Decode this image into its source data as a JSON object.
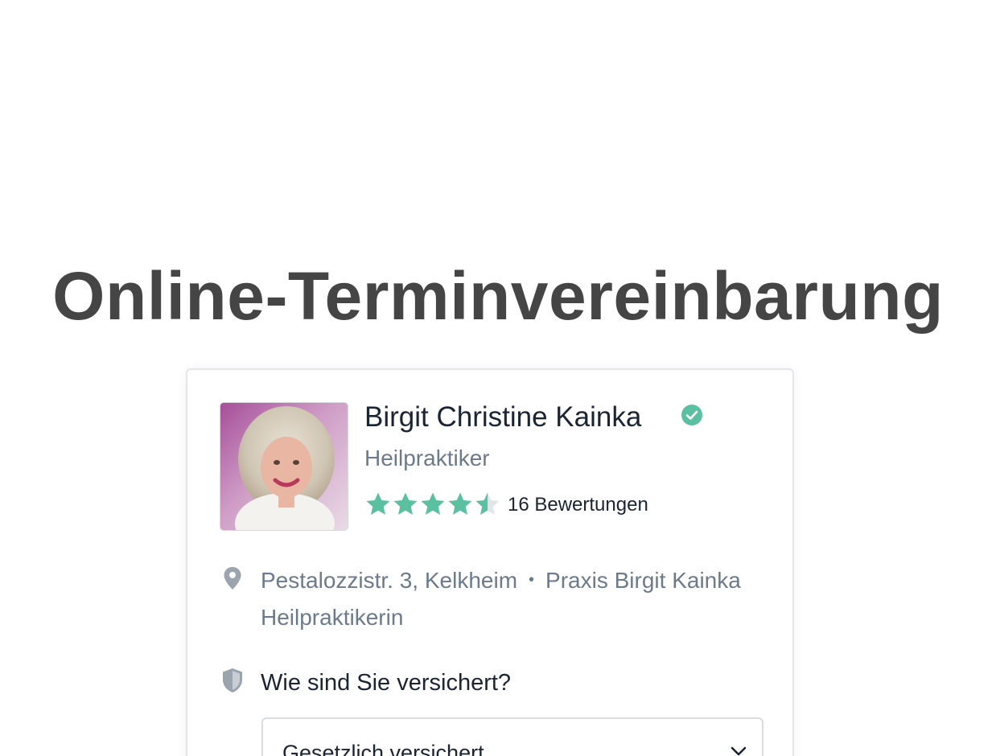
{
  "page": {
    "title": "Online-Terminvereinbarung"
  },
  "profile": {
    "name": "Birgit Christine Kainka",
    "verified": true,
    "specialty": "Heilpraktiker",
    "rating": 4.5,
    "rating_max": 5,
    "reviews_label": "16 Bewertungen",
    "avatar_icon": "profile-photo",
    "verified_icon": "check-circle-icon",
    "star_color": "#5bc0a0",
    "star_empty_color": "#e2e4e8"
  },
  "location": {
    "icon": "map-pin-icon",
    "address": "Pestalozzistr. 3, Kelkheim",
    "separator": "•",
    "practice": "Praxis Birgit Kainka Heilpraktikerin"
  },
  "insurance": {
    "icon": "shield-icon",
    "question": "Wie sind Sie versichert?",
    "selected": "Gesetzlich versichert"
  },
  "colors": {
    "title": "#454545",
    "text_primary": "#1b2433",
    "text_secondary": "#6c7a8b",
    "accent": "#5bc0a0"
  }
}
